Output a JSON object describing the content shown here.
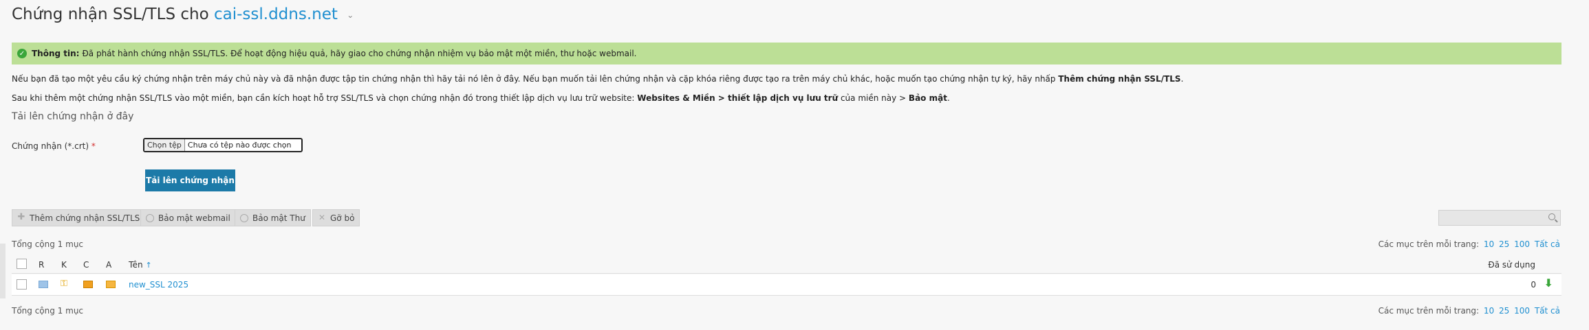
{
  "header": {
    "title_prefix": "Chứng nhận SSL/TLS cho",
    "domain": "cai-ssl.ddns.net"
  },
  "alert": {
    "label": "Thông tin:",
    "message": "Đã phát hành chứng nhận SSL/TLS. Để hoạt động hiệu quả, hãy giao cho chứng nhận nhiệm vụ bảo mật một miền, thư hoặc webmail."
  },
  "info": {
    "line1_text": "Nếu bạn đã tạo một yêu cầu ký chứng nhận trên máy chủ này và đã nhận được tập tin chứng nhận thì hãy tải nó lên ở đây. Nếu bạn muốn tải lên chứng nhận và cặp khóa riêng được tạo ra trên máy chủ khác, hoặc muốn tạo chứng nhận tự ký, hãy nhấp",
    "line1_bold": "Thêm chứng nhận SSL/TLS",
    "line1_end": ".",
    "line2_text": "Sau khi thêm một chứng nhận SSL/TLS vào một miền, bạn cần kích hoạt hỗ trợ SSL/TLS và chọn chứng nhận đó trong thiết lập dịch vụ lưu trữ website:",
    "line2_bold1": "Websites & Miền > thiết lập dịch vụ lưu trữ",
    "line2_mid": "của miền này >",
    "line2_bold2": "Bảo mật",
    "line2_end": "."
  },
  "upload": {
    "section_title": "Tải lên chứng nhận ở đây",
    "field_label": "Chứng nhận (*.crt)",
    "required_mark": "*",
    "choose_label": "Chọn tệp",
    "no_file_text": "Chưa có tệp nào được chọn",
    "button_label": "Tải lên chứng nhận"
  },
  "toolbar": {
    "add_label": "Thêm chứng nhận SSL/TLS",
    "webmail_label": "Bảo mật webmail",
    "mail_label": "Bảo mật Thư",
    "remove_label": "Gỡ bỏ"
  },
  "list": {
    "total_text": "Tổng cộng 1 mục",
    "per_page_label": "Các mục trên mỗi trang:",
    "per_page_options": [
      "10",
      "25",
      "100",
      "Tất cả"
    ],
    "columns": {
      "r": "R",
      "k": "K",
      "c": "C",
      "a": "A",
      "name": "Tên",
      "sort_arrow": "↑",
      "used": "Đã sử dụng"
    },
    "rows": [
      {
        "name": "new_SSL 2025",
        "used": "0"
      }
    ]
  },
  "colors": {
    "accent": "#1f8fd0",
    "alert_bg": "#bcdf96",
    "primary_button": "#1c7aa8",
    "ok_green": "#3aa63a"
  }
}
